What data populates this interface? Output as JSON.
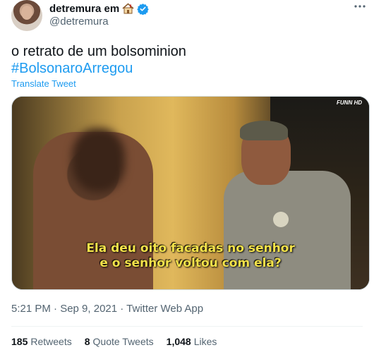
{
  "tweet": {
    "display_name": "detremura em",
    "handle": "@detremura",
    "text": "o retrato de um bolsominion",
    "hashtag": "#BolsonaroArregou",
    "translate": "Translate Tweet",
    "media": {
      "caption_line1": "Ela deu oito facadas no senhor",
      "caption_line2": "e o senhor voltou com ela?",
      "logo": "FUNN HD"
    },
    "timestamp": "5:21 PM · Sep 9, 2021 · Twitter Web App",
    "stats": {
      "retweets_count": "185",
      "retweets_label": "Retweets",
      "quotes_count": "8",
      "quotes_label": "Quote Tweets",
      "likes_count": "1,048",
      "likes_label": "Likes"
    }
  },
  "colors": {
    "accent": "#1d9bf0",
    "muted": "#536471",
    "caption": "#f3e24a"
  },
  "icons": [
    "house-emoji-icon",
    "verified-icon",
    "more-icon"
  ]
}
